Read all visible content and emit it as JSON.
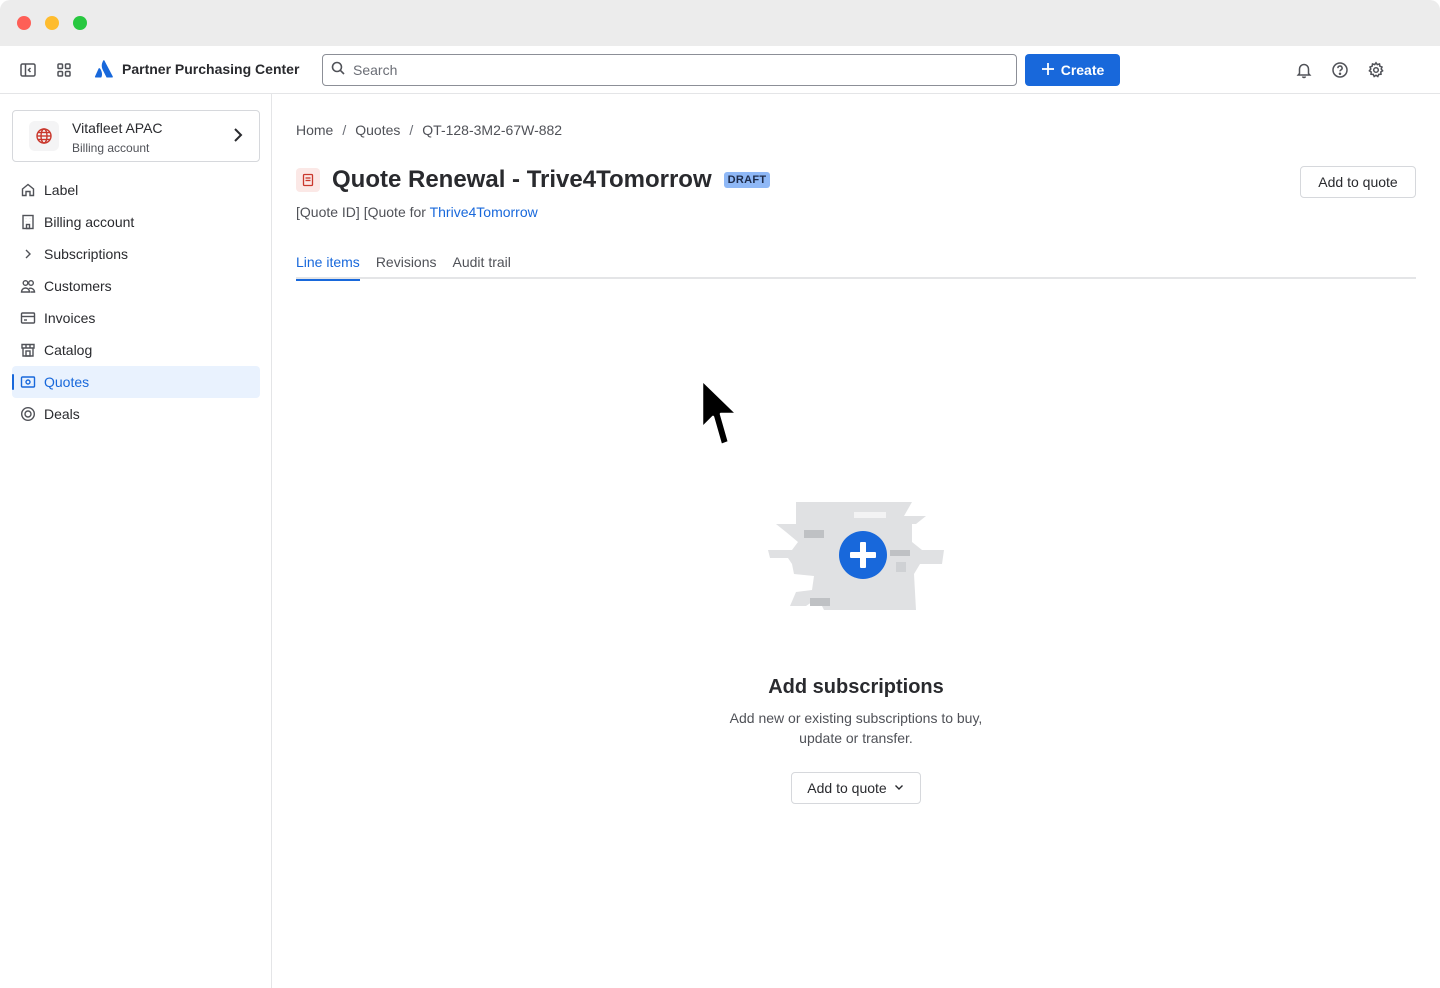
{
  "topnav": {
    "app_name": "Partner Purchasing Center",
    "search_placeholder": "Search",
    "create_label": "Create"
  },
  "sidebar": {
    "account": {
      "name": "Vitafleet APAC",
      "subtitle": "Billing account"
    },
    "items": [
      {
        "label": "Label",
        "icon": "home-icon"
      },
      {
        "label": "Billing account",
        "icon": "building-icon"
      },
      {
        "label": "Subscriptions",
        "icon": "chevron-right-icon"
      },
      {
        "label": "Customers",
        "icon": "people-icon"
      },
      {
        "label": "Invoices",
        "icon": "card-icon"
      },
      {
        "label": "Catalog",
        "icon": "store-icon"
      },
      {
        "label": "Quotes",
        "icon": "quote-icon",
        "active": true
      },
      {
        "label": "Deals",
        "icon": "target-icon"
      }
    ]
  },
  "main": {
    "breadcrumb": [
      "Home",
      "Quotes",
      "QT-128-3M2-67W-882"
    ],
    "title": "Quote Renewal - Trive4Tomorrow",
    "status": "DRAFT",
    "subtitle_prefix": "[Quote ID] [Quote for ",
    "subtitle_link": "Thrive4Tomorrow",
    "add_to_quote_label": "Add to quote",
    "tabs": [
      "Line items",
      "Revisions",
      "Audit trail"
    ],
    "empty_state": {
      "title": "Add subscriptions",
      "description": "Add new or existing subscriptions to buy, update or transfer.",
      "button_label": "Add to quote"
    }
  },
  "colors": {
    "brand": "#1868db",
    "active_bg": "#e9f2fe",
    "lozenge": "#8fb8f6"
  }
}
